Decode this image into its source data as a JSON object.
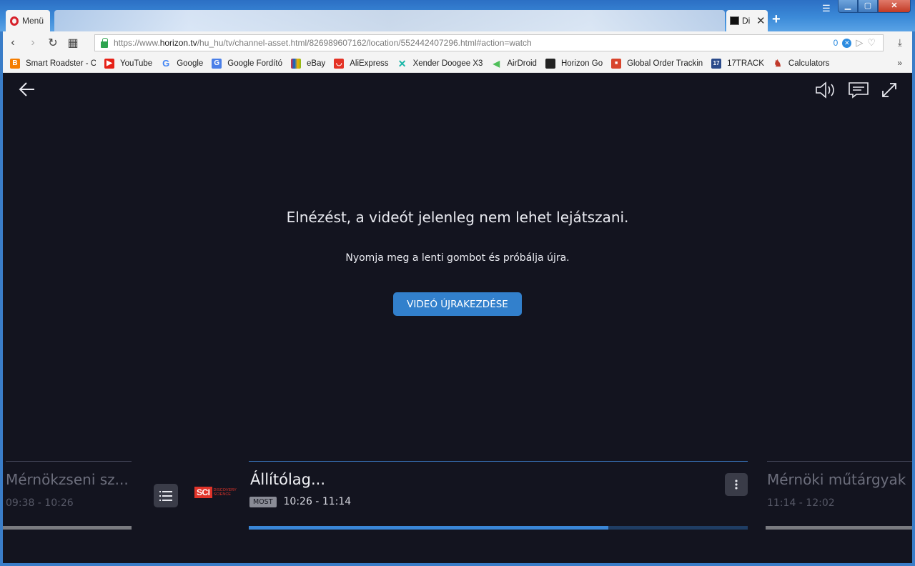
{
  "browser": {
    "menu_label": "Menü",
    "active_tab_title": "Di",
    "url_prefix": "https://www.",
    "url_host": "horizon.tv",
    "url_path": "/hu_hu/tv/channel-asset.html/826989607162/location/552442407296.html#action=watch",
    "badge_count": "0"
  },
  "bookmarks": [
    {
      "label": "Smart Roadster - Con",
      "icon": "blogger-icon",
      "color": "#f57d00"
    },
    {
      "label": "YouTube",
      "icon": "youtube-icon",
      "color": "#e62117"
    },
    {
      "label": "Google",
      "icon": "google-icon",
      "color": "#4285f4"
    },
    {
      "label": "Google Fordító",
      "icon": "translate-icon",
      "color": "#4a7fe8"
    },
    {
      "label": "eBay",
      "icon": "ebay-icon",
      "color": "#e53238"
    },
    {
      "label": "AliExpress",
      "icon": "aliexpress-icon",
      "color": "#e43225"
    },
    {
      "label": "Xender Doogee X3",
      "icon": "xender-icon",
      "color": "#1ab6a8"
    },
    {
      "label": "AirDroid",
      "icon": "airdroid-icon",
      "color": "#4fbf5a"
    },
    {
      "label": "Horizon Go",
      "icon": "horizon-icon",
      "color": "#222222"
    },
    {
      "label": "Global Order Tracking",
      "icon": "tracking-icon",
      "color": "#d8442c"
    },
    {
      "label": "17TRACK",
      "icon": "17track-icon",
      "color": "#2a4a8a"
    },
    {
      "label": "Calculators",
      "icon": "calculator-icon",
      "color": "#c0392b"
    }
  ],
  "player": {
    "error_title": "Elnézést, a videót jelenleg nem lehet lejátszani.",
    "error_subtitle": "Nyomja meg a lenti gombot és próbálja újra.",
    "restart_button": "VIDEÓ ÚJRAKEZDÉSE"
  },
  "programs": {
    "previous": {
      "title": "Mérnökzseni sz...",
      "time": "09:38 - 10:26"
    },
    "current": {
      "title": "Állítólag...",
      "badge": "MOST",
      "time": "10:26 - 11:14",
      "progress": 0.72
    },
    "next": {
      "title": "Mérnöki műtárgyak",
      "time": "11:14 - 12:02"
    }
  },
  "channel": {
    "logo_text": "SCI",
    "logo_subtext": "DISCOVERY SCIENCE"
  },
  "colors": {
    "accent": "#3280cc",
    "player_bg": "#13141f"
  }
}
